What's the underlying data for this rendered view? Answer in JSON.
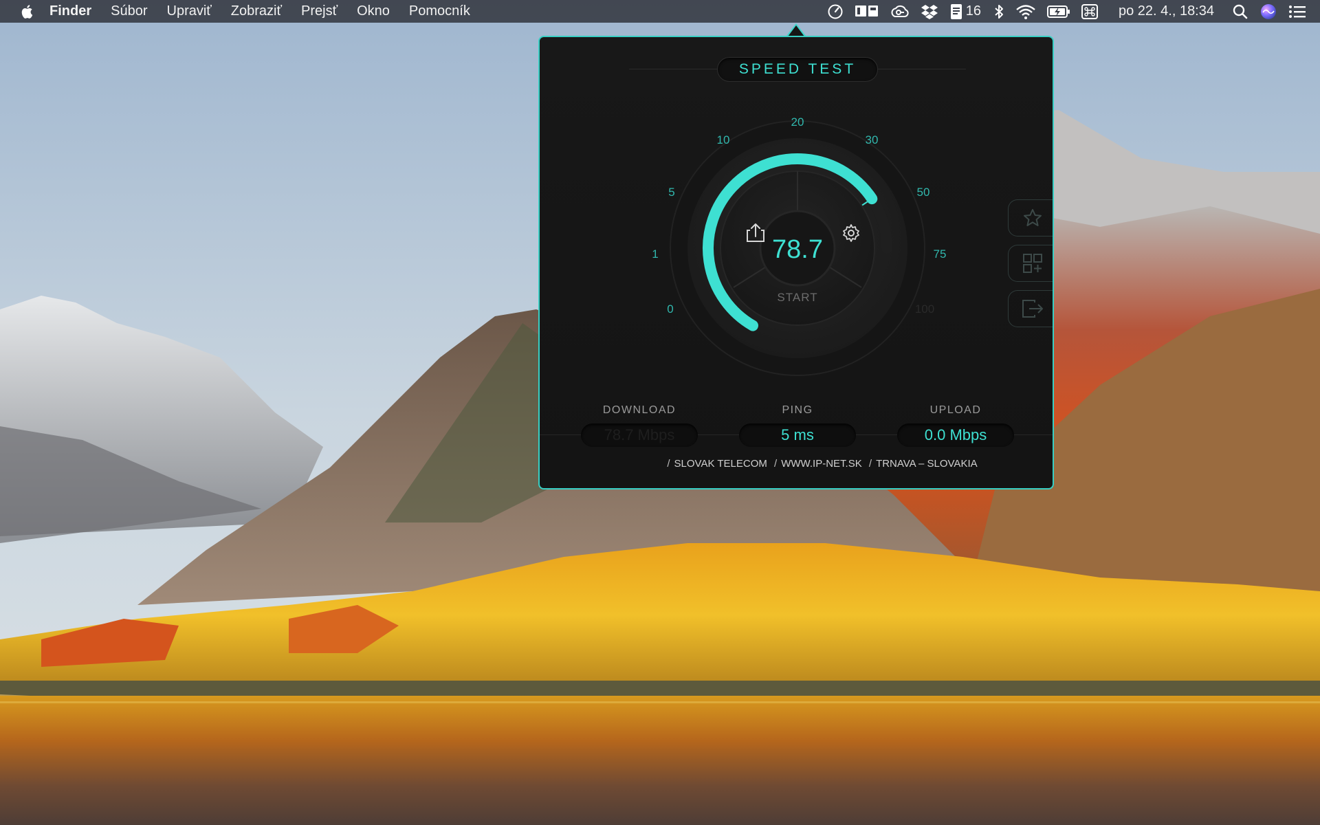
{
  "menubar": {
    "apple_icon": "apple-logo-icon",
    "app_name": "Finder",
    "menus": [
      "Súbor",
      "Upraviť",
      "Zobraziť",
      "Prejsť",
      "Okno",
      "Pomocník"
    ],
    "status_icons": [
      "speedtest-gauge-icon",
      "monitor-icon",
      "creative-cloud-icon",
      "dropbox-icon",
      "notes-icon",
      "bluetooth-icon",
      "wifi-icon",
      "battery-charging-icon",
      "keyboard-input-icon",
      "spotlight-search-icon",
      "siri-icon",
      "notification-center-icon"
    ],
    "notes_count": "16",
    "clock": "po 22. 4., 18:34"
  },
  "speed_test": {
    "title": "SPEED TEST",
    "gauge": {
      "ticks": [
        "0",
        "1",
        "5",
        "10",
        "20",
        "30",
        "50",
        "75",
        "100"
      ],
      "value": "78.7",
      "fill_fraction": 0.86,
      "start_label": "START",
      "accent_color": "#3ee0d2"
    },
    "side_buttons": [
      "star-icon",
      "add-widget-icon",
      "logout-icon"
    ],
    "stats": {
      "download": {
        "label": "DOWNLOAD",
        "value": "78.7 Mbps"
      },
      "ping": {
        "label": "PING",
        "value": "5 ms"
      },
      "upload": {
        "label": "UPLOAD",
        "value": "0.0 Mbps"
      }
    },
    "server": {
      "isp": "SLOVAK TELECOM",
      "host": "WWW.IP-NET.SK",
      "location": "TRNAVA – SLOVAKIA"
    }
  }
}
